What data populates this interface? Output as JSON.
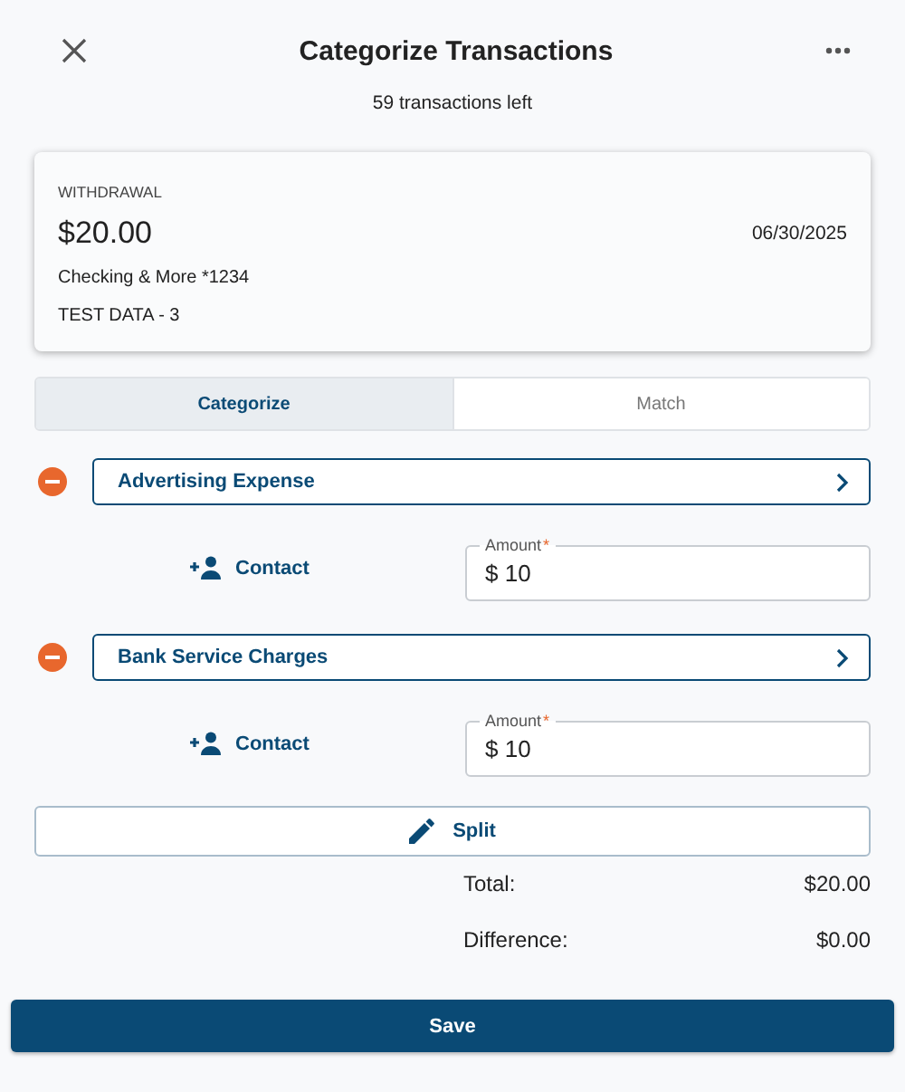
{
  "header": {
    "title": "Categorize Transactions",
    "subtitle": "59 transactions left"
  },
  "transaction": {
    "type": "WITHDRAWAL",
    "amount": "$20.00",
    "date": "06/30/2025",
    "account": "Checking & More *1234",
    "description": "TEST DATA - 3"
  },
  "tabs": [
    {
      "label": "Categorize",
      "selected": true
    },
    {
      "label": "Match",
      "selected": false
    }
  ],
  "splits": [
    {
      "category": "Advertising Expense",
      "contact": "Contact",
      "amount_label": "Amount",
      "required_mark": "*",
      "amount": "$ 10"
    },
    {
      "category": "Bank Service Charges",
      "contact": "Contact",
      "amount_label": "Amount",
      "required_mark": "*",
      "amount": "$ 10"
    }
  ],
  "split_button": "Split",
  "totals": [
    {
      "label": "Total:",
      "value": "$20.00"
    },
    {
      "label": "Difference:",
      "value": "$0.00"
    }
  ],
  "save_button": "Save"
}
